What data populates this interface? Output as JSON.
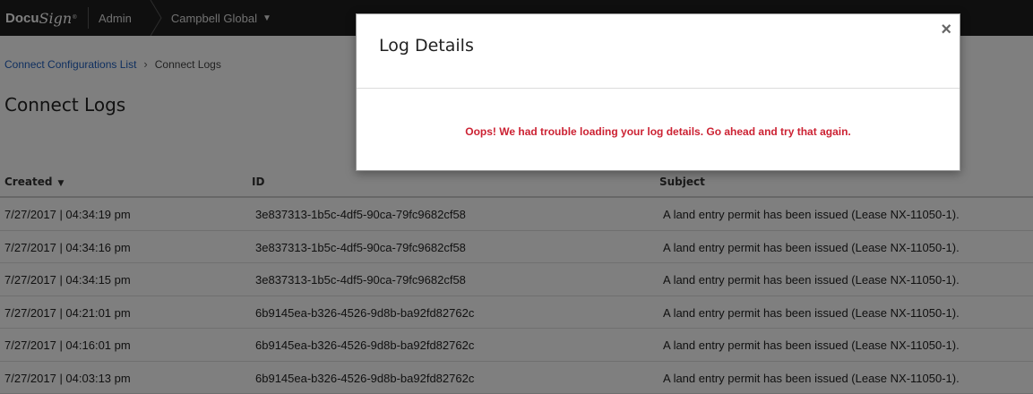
{
  "topbar": {
    "logo_text": "Docu",
    "logo_sign": "Sign",
    "logo_tm": "®",
    "section": "Admin",
    "account_name": "Campbell Global",
    "account_caret": "▼"
  },
  "breadcrumb": {
    "parent": "Connect Configurations List",
    "separator": "›",
    "current": "Connect Logs"
  },
  "page": {
    "title": "Connect Logs"
  },
  "table": {
    "headers": {
      "created": "Created",
      "id": "ID",
      "subject": "Subject"
    },
    "sort_caret": "▼",
    "rows": [
      {
        "created": "7/27/2017 | 04:34:19 pm",
        "id": "3e837313-1b5c-4df5-90ca-79fc9682cf58",
        "subject": "A land entry permit has been issued (Lease NX-11050-1)."
      },
      {
        "created": "7/27/2017 | 04:34:16 pm",
        "id": "3e837313-1b5c-4df5-90ca-79fc9682cf58",
        "subject": "A land entry permit has been issued (Lease NX-11050-1)."
      },
      {
        "created": "7/27/2017 | 04:34:15 pm",
        "id": "3e837313-1b5c-4df5-90ca-79fc9682cf58",
        "subject": "A land entry permit has been issued (Lease NX-11050-1)."
      },
      {
        "created": "7/27/2017 | 04:21:01 pm",
        "id": "6b9145ea-b326-4526-9d8b-ba92fd82762c",
        "subject": "A land entry permit has been issued (Lease NX-11050-1)."
      },
      {
        "created": "7/27/2017 | 04:16:01 pm",
        "id": "6b9145ea-b326-4526-9d8b-ba92fd82762c",
        "subject": "A land entry permit has been issued (Lease NX-11050-1)."
      },
      {
        "created": "7/27/2017 | 04:03:13 pm",
        "id": "6b9145ea-b326-4526-9d8b-ba92fd82762c",
        "subject": "A land entry permit has been issued (Lease NX-11050-1)."
      }
    ]
  },
  "modal": {
    "title": "Log Details",
    "close": "×",
    "error": "Oops! We had trouble loading your log details. Go ahead and try that again."
  },
  "colors": {
    "topbar_bg": "#1e1e1e",
    "link": "#1f5fbf",
    "error": "#cc2233",
    "overlay": "rgba(0,0,0,0.5)"
  },
  "icons": {
    "close": "close-icon",
    "sort": "caret-down-icon",
    "account_dropdown": "chevron-down-icon",
    "breadcrumb_separator": "chevron-right-icon"
  }
}
